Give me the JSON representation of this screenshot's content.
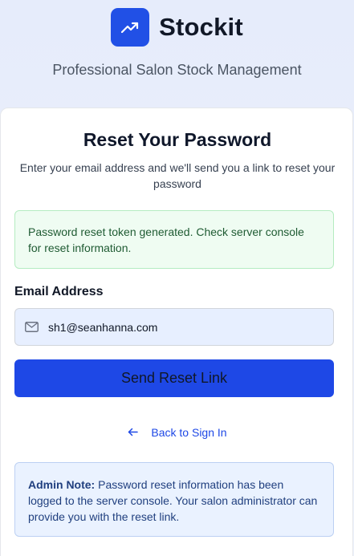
{
  "brand": {
    "name": "Stockit",
    "tagline": "Professional Salon Stock Management",
    "logo_icon": "trending-up-icon",
    "accent_color": "#2150e6"
  },
  "card": {
    "title": "Reset Your Password",
    "subtitle": "Enter your email address and we'll send you a link to reset your password"
  },
  "alert": {
    "type": "success",
    "message": "Password reset token generated. Check server console for reset information."
  },
  "form": {
    "email_label": "Email Address",
    "email_value": "sh1@seanhanna.com",
    "email_icon": "mail-icon",
    "submit_label": "Send Reset Link"
  },
  "back_link": {
    "icon": "arrow-left-icon",
    "label": "Back to Sign In"
  },
  "admin_note": {
    "title": "Admin Note:",
    "message": " Password reset information has been logged to the server console. Your salon administrator can provide you with the reset link."
  }
}
